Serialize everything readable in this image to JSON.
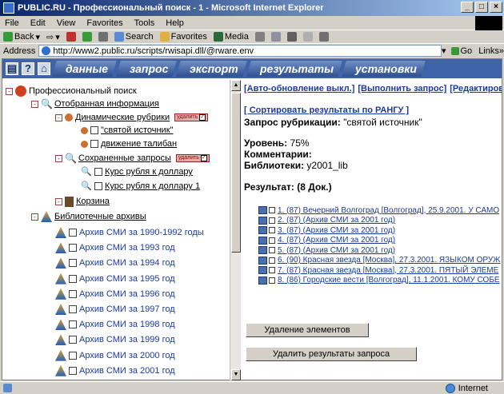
{
  "window": {
    "title": "PUBLIC.RU - Профессиональный поиск - 1 - Microsoft Internet Explorer"
  },
  "menu": [
    "File",
    "Edit",
    "View",
    "Favorites",
    "Tools",
    "Help"
  ],
  "toolbar": {
    "back": "Back",
    "search": "Search",
    "favorites": "Favorites",
    "media": "Media"
  },
  "address": {
    "label": "Address",
    "url": "http://www2.public.ru/scripts/rwisapi.dll/@rware.env",
    "go": "Go",
    "links": "Links"
  },
  "nav": {
    "help": "?",
    "tabs": [
      "данные",
      "запрос",
      "экспорт",
      "результаты",
      "установки"
    ]
  },
  "tree": {
    "root": "Профессиональный поиск",
    "selected": "Отобранная информация",
    "dynamic": "Динамические рубрики",
    "badge": "удалить",
    "dynamic_items": [
      "\"святой источник\"",
      "движение талибан"
    ],
    "saved": "Сохраненные запросы",
    "saved_items": [
      "Курс рубля к доллару",
      "Курс рубля к доллару 1"
    ],
    "basket": "Корзина",
    "archives": "Библиотечные архивы",
    "archive_items": [
      "Архив СМИ за 1990-1992 годы",
      "Архив СМИ за 1993 год",
      "Архив СМИ за 1994 год",
      "Архив СМИ за 1995 год",
      "Архив СМИ за 1996 год",
      "Архив СМИ за 1997 год",
      "Архив СМИ за 1998 год",
      "Архив СМИ за 1999 год",
      "Архив СМИ за 2000 год",
      "Архив СМИ за 2001 год"
    ]
  },
  "right": {
    "links": [
      "[Авто-обновление выкл.]",
      "[Выполнить запрос]",
      "[Редактировать з"
    ],
    "sort": "[ Сортировать результаты по РАНГУ ]",
    "query_label": "Запрос рубрикации:",
    "query_value": "\"святой источник\"",
    "level_label": "Уровень:",
    "level_value": "75%",
    "comments_label": "Комментарии:",
    "libs_label": "Библиотеки:",
    "libs_value": "y2001_lib",
    "result_label": "Результат: (8 Док.)",
    "results": [
      "1. (87) Вечерний Волгоград [Волгоград], 25.9.2001. У САМО",
      "2. (87) (Архив СМИ за 2001 год)",
      "3. (87) (Архив СМИ за 2001 год)",
      "4. (87) (Архив СМИ за 2001 год)",
      "5. (87) (Архив СМИ за 2001 год)",
      "6. (90) Красная звезда [Москва], 27.3.2001. ЯЗЫКОМ ОРУЖ",
      "7. (87) Красная звезда [Москва], 27.3.2001. ПЯТЫЙ ЭЛЕМЕ",
      "8. (86) Городские вести [Волгоград], 11.1.2001. КОМУ СОБЕ"
    ],
    "delete_items": "Удаление элементов",
    "delete_results": "Удалить результаты запроса"
  },
  "status": {
    "zone": "Internet"
  }
}
